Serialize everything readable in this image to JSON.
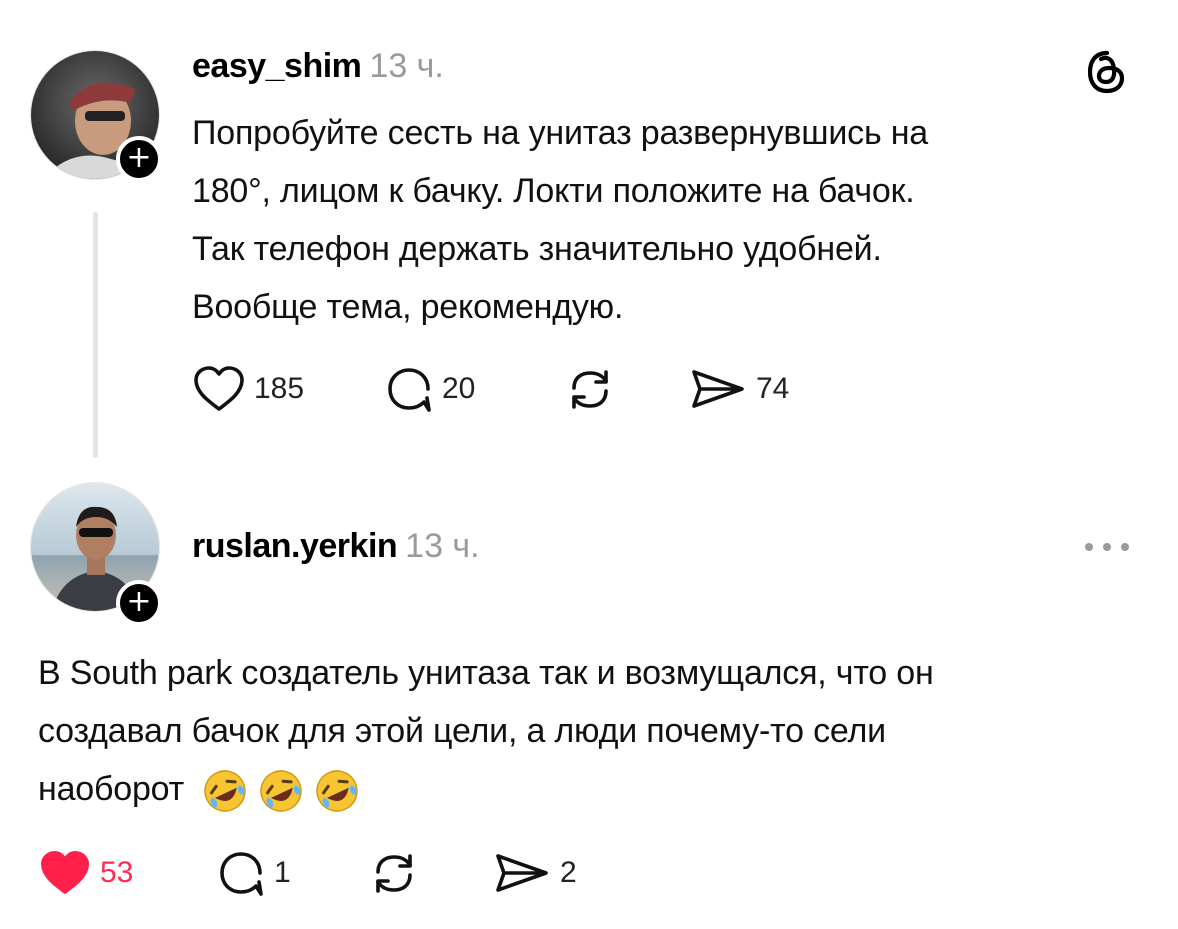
{
  "posts": [
    {
      "username": "easy_shim",
      "time": "13 ч.",
      "text_lines": [
        "Попробуйте сесть на унитаз развернувшись на",
        "180°, лицом к бачку. Локти положите на бачок.",
        "Так телефон держать значительно удобней.",
        "Вообще тема, рекомендую."
      ],
      "likes": "185",
      "replies": "20",
      "shares": "74",
      "liked": false
    },
    {
      "username": "ruslan.yerkin",
      "time": "13 ч.",
      "text_lines": [
        "В South park создатель унитаза так и возмущался, что он",
        "создавал бачок для этой цели, а люди почему-то сели",
        "наоборот"
      ],
      "emoji": "🤣🤣🤣",
      "likes": "53",
      "replies": "1",
      "shares": "2",
      "liked": true
    }
  ],
  "icons": {
    "top_right": "threads-logo-icon",
    "more": "more-dots-icon",
    "follow": "+"
  },
  "colors": {
    "liked": "#ff2b55",
    "muted": "#9a9a9a",
    "thread_line": "#e3e3e3"
  }
}
